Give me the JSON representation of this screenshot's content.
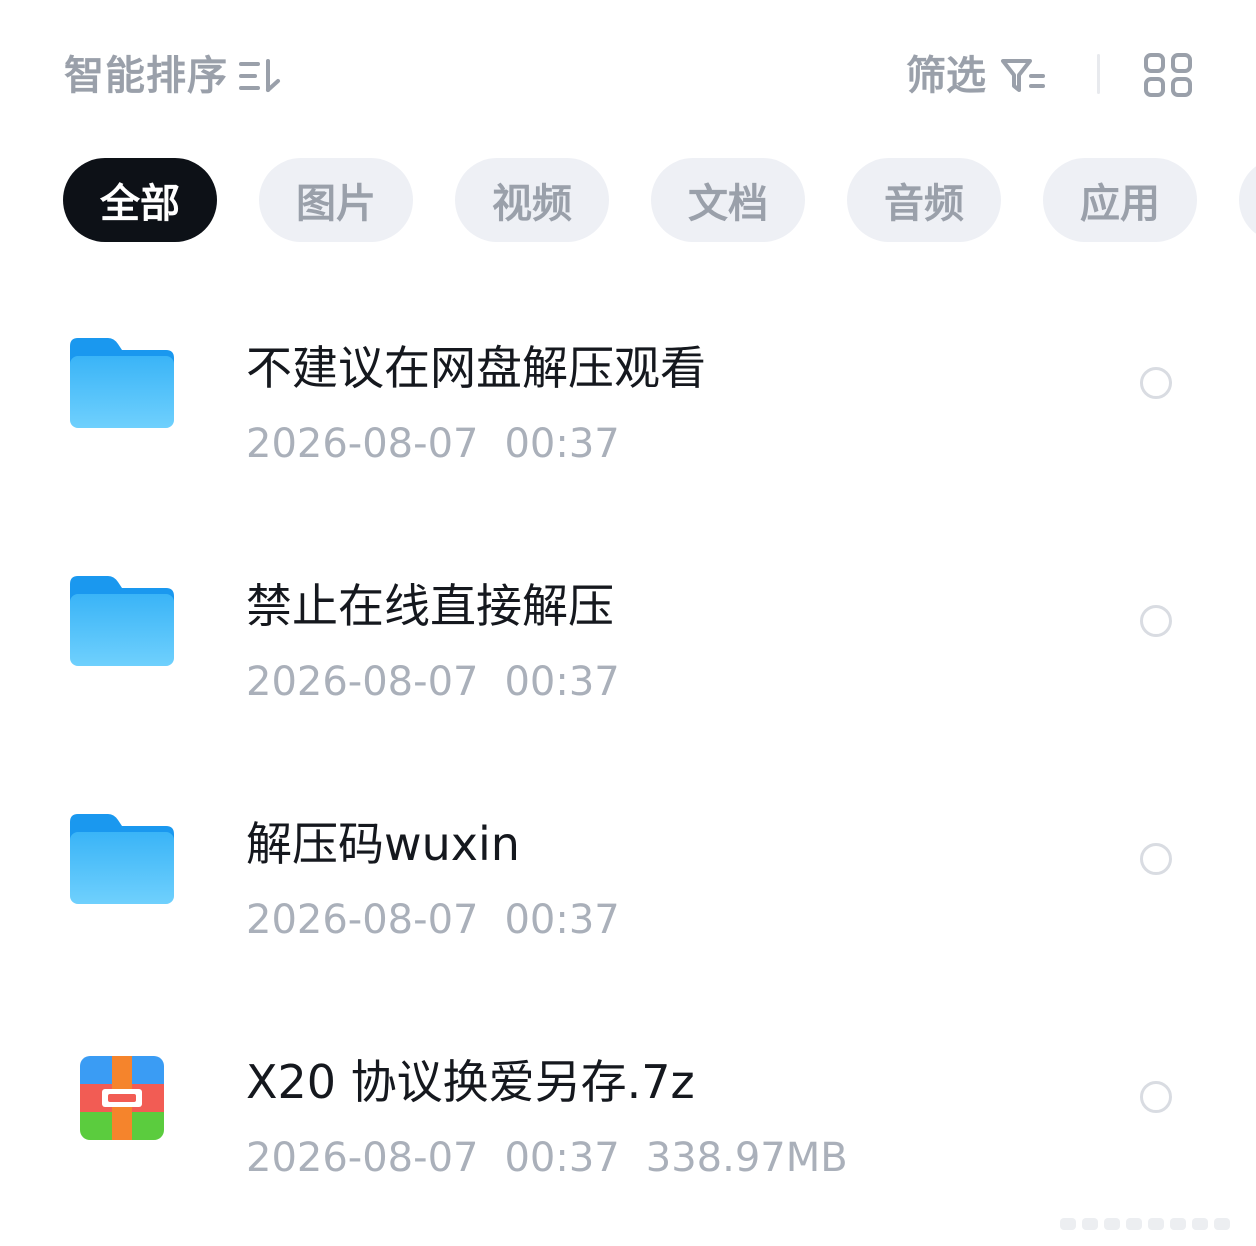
{
  "toolbar": {
    "sort_label": "智能排序",
    "filter_label": "筛选"
  },
  "tabs": [
    {
      "label": "全部",
      "active": true
    },
    {
      "label": "图片",
      "active": false
    },
    {
      "label": "视频",
      "active": false
    },
    {
      "label": "文档",
      "active": false
    },
    {
      "label": "音频",
      "active": false
    },
    {
      "label": "应用",
      "active": false
    }
  ],
  "files": [
    {
      "name": "不建议在网盘解压观看",
      "date": "2026-08-07",
      "time": "00:37",
      "size": "",
      "type": "folder"
    },
    {
      "name": "禁止在线直接解压",
      "date": "2026-08-07",
      "time": "00:37",
      "size": "",
      "type": "folder"
    },
    {
      "name": "解压码wuxin",
      "date": "2026-08-07",
      "time": "00:37",
      "size": "",
      "type": "folder"
    },
    {
      "name": "X20 协议换爱另存.7z",
      "date": "2026-08-07",
      "time": "00:37",
      "size": "338.97MB",
      "type": "archive"
    }
  ],
  "colors": {
    "accent_dark": "#0d1117",
    "muted_text": "#9aa0aa",
    "tab_bg": "#eef0f5",
    "folder_blue": "#29a9f5"
  },
  "icons": [
    "sort-icon",
    "filter-icon",
    "grid-view-icon",
    "folder-icon",
    "archive-icon"
  ]
}
